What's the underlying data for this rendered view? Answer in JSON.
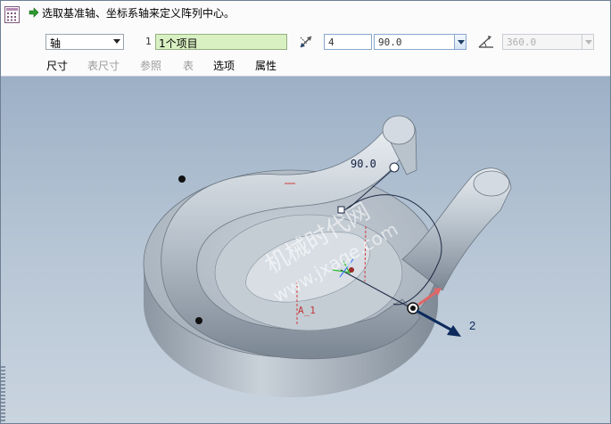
{
  "dashboard": {
    "prompt": "选取基准轴、坐标系轴来定义阵列中心。",
    "pattern_type": "轴",
    "reference_index": "1",
    "reference_collector": "1个项目",
    "member_count": "4",
    "angle_increment": "90.0",
    "total_angle": "360.0",
    "tabs": [
      {
        "label": "尺寸",
        "enabled": true
      },
      {
        "label": "表尺寸",
        "enabled": false
      },
      {
        "label": "参照",
        "enabled": false
      },
      {
        "label": "表",
        "enabled": false
      },
      {
        "label": "选项",
        "enabled": true
      },
      {
        "label": "属性",
        "enabled": true
      }
    ]
  },
  "viewport": {
    "angle_dimension": "90.0",
    "axis_label": "A_1",
    "direction_label": "2",
    "watermark": [
      "机械时代网",
      "www.jxage.com"
    ],
    "colors": {
      "background_top": "#9cb0c6",
      "part": "#b8c2cc",
      "drag_arrow": "#0d2a5c",
      "preview_arrow": "#e06666"
    }
  }
}
